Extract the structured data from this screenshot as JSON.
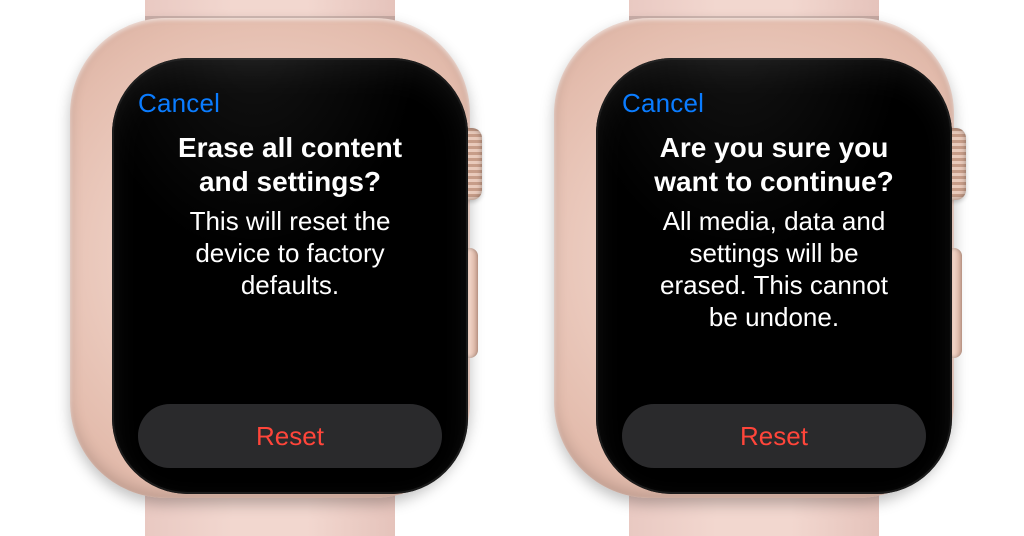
{
  "colors": {
    "link": "#0a7cff",
    "danger": "#ff453a",
    "buttonBg": "#2a2a2c"
  },
  "screens": [
    {
      "cancel": "Cancel",
      "title": "Erase all content\nand settings?",
      "body": "This will reset the\ndevice to factory\ndefaults.",
      "reset": "Reset"
    },
    {
      "cancel": "Cancel",
      "title": "Are you sure you\nwant to continue?",
      "body": "All media, data and\nsettings will be\nerased. This cannot\nbe undone.",
      "reset": "Reset"
    }
  ]
}
